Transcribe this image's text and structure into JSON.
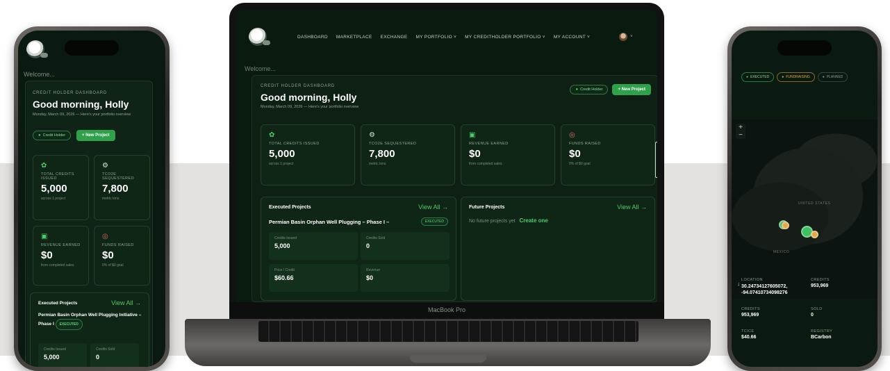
{
  "app": {
    "welcome": "Welcome...",
    "dashboard_eyebrow": "CREDIT HOLDER DASHBOARD",
    "greeting": "Good morning, Holly",
    "date_line": "Monday, March 09, 2026 — Here's your portfolio overview",
    "btn_credit_holder": "Credit Holder",
    "btn_new_project": "+ New Project"
  },
  "nav": {
    "items": [
      "DASHBOARD",
      "MARKETPLACE",
      "EXCHANGE",
      "MY PORTFOLIO ˅",
      "MY CREDITHOLDER PORTFOLIO ˅",
      "MY ACCOUNT ˅"
    ],
    "avatar_caret": "˅"
  },
  "stats": [
    {
      "icon": "sprout-icon",
      "glyph": "✿",
      "label": "TOTAL CREDITS ISSUED",
      "value": "5,000",
      "sub": "across 1 project"
    },
    {
      "icon": "tool-icon",
      "glyph": "⚙",
      "label": "TCO2E SEQUESTERED",
      "value": "7,800",
      "sub": "metric tons"
    },
    {
      "icon": "cash-icon",
      "glyph": "▣",
      "label": "REVENUE EARNED",
      "value": "$0",
      "sub": "from completed sales"
    },
    {
      "icon": "target-icon",
      "glyph": "◎",
      "label": "FUNDS RAISED",
      "value": "$0",
      "sub": "0% of $0 goal"
    }
  ],
  "executed": {
    "title": "Executed Projects",
    "view_all": "View All →",
    "project_name_laptop": "Permian Basin Orphan Well Plugging – Phase I –",
    "project_name_phone": "Permian Basin Orphan Well Plugging Initiative – Phase I",
    "status": "EXECUTED",
    "credits_issued_label": "Credits Issued",
    "credits_issued": "5,000",
    "credits_sold_label": "Credits Sold",
    "credits_sold": "0",
    "price_label": "Price / Credit",
    "price": "$60.66",
    "revenue_label": "Revenue",
    "revenue": "$0"
  },
  "future": {
    "title": "Future Projects",
    "view_all": "View All →",
    "empty": "No future projects yet",
    "create": "Create one"
  },
  "laptop": {
    "model": "MacBook Pro"
  },
  "map": {
    "chips": [
      {
        "label": "EXECUTED",
        "color": "#4ccb6a"
      },
      {
        "label": "FUNDRAISING",
        "color": "#e0a84a"
      },
      {
        "label": "PLANNED",
        "color": "#8a9a8e"
      }
    ],
    "zoom_in": "+",
    "zoom_out": "−",
    "label_us": "UNITED STATES",
    "label_mexico": "MEXICO",
    "arrow": "↓",
    "location_label": "LOCATION",
    "location_value": "30.24734127605072, -94.07410734098276",
    "credits_label": "CREDITS",
    "credits_value": "953,969",
    "credits2_label": "CREDITS",
    "credits2_value": "953,969",
    "sold_label": "SOLD",
    "sold_value": "0",
    "price_label": "TCICE",
    "price_value": "$40.66",
    "registry_label": "REGISTRY",
    "registry_value": "BCarbon"
  }
}
